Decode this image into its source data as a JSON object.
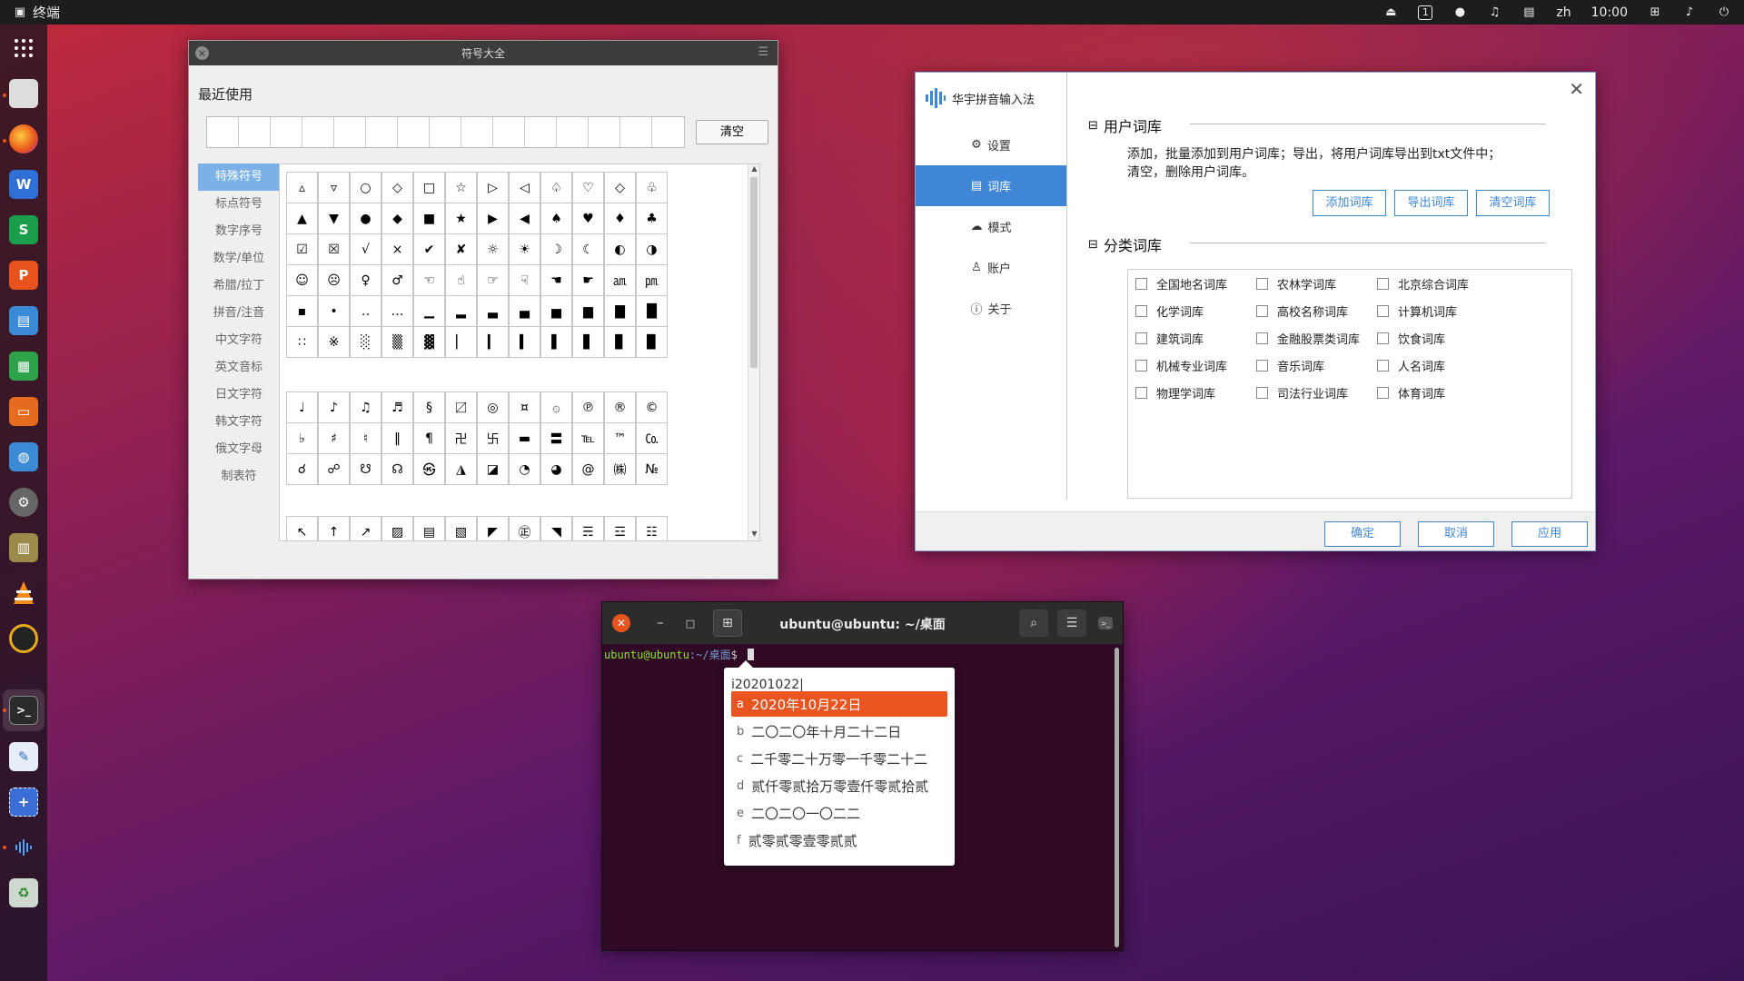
{
  "topbar": {
    "app_name": "终端",
    "lang": "zh",
    "time": "10:00"
  },
  "symbol_window": {
    "title": "符号大全",
    "recent_label": "最近使用",
    "clear_label": "清空",
    "categories": [
      "特殊符号",
      "标点符号",
      "数字序号",
      "数学/单位",
      "希腊/拉丁",
      "拼音/注音",
      "中文字符",
      "英文音标",
      "日文字符",
      "韩文字符",
      "俄文字母",
      "制表符"
    ],
    "grid1": [
      "▵",
      "▿",
      "○",
      "◇",
      "□",
      "☆",
      "▷",
      "◁",
      "♤",
      "♡",
      "◇",
      "♧",
      "▲",
      "▼",
      "●",
      "◆",
      "■",
      "★",
      "▶",
      "◀",
      "♠",
      "♥",
      "♦",
      "♣",
      "☑",
      "☒",
      "√",
      "×",
      "✔",
      "✘",
      "☼",
      "☀",
      "☽",
      "☾",
      "◐",
      "◑",
      "☺",
      "☹",
      "♀",
      "♂",
      "☜",
      "☝",
      "☞",
      "☟",
      "☚",
      "☛",
      "㏂",
      "㏘",
      "▪",
      "•",
      "‥",
      "…",
      "▁",
      "▂",
      "▃",
      "▄",
      "▅",
      "▆",
      "▇",
      "█",
      "∷",
      "※",
      "░",
      "▒",
      "▓",
      "▏",
      "▎",
      "▍",
      "▌",
      "▋",
      "▊",
      "▉"
    ],
    "grid2": [
      "♩",
      "♪",
      "♫",
      "♬",
      "§",
      "〼",
      "◎",
      "¤",
      "۞",
      "℗",
      "®",
      "©",
      "♭",
      "♯",
      "♮",
      "‖",
      "¶",
      "卍",
      "卐",
      "▬",
      "〓",
      "℡",
      "™",
      "㏇",
      "☌",
      "☍",
      "☋",
      "☊",
      "㉿",
      "◮",
      "◪",
      "◔",
      "◕",
      "@",
      "㈱",
      "№"
    ],
    "grid3": [
      "↖",
      "↑",
      "↗",
      "▨",
      "▤",
      "▧",
      "◤",
      "㊣",
      "◥",
      "☴",
      "☲",
      "☷"
    ]
  },
  "settings_window": {
    "app_name": "华宇拼音输入法",
    "nav": [
      "设置",
      "词库",
      "模式",
      "账户",
      "关于"
    ],
    "active_nav": "词库",
    "user_dict_title": "用户词库",
    "user_dict_desc_1": "添加，批量添加到用户词库；导出，将用户词库导出到txt文件中；",
    "user_dict_desc_2": "清空，删除用户词库。",
    "btn_add": "添加词库",
    "btn_export": "导出词库",
    "btn_clear": "清空词库",
    "category_title": "分类词库",
    "dicts": [
      [
        "全国地名词库",
        "农林学词库",
        "北京综合词库"
      ],
      [
        "化学词库",
        "高校名称词库",
        "计算机词库"
      ],
      [
        "建筑词库",
        "金融股票类词库",
        "饮食词库"
      ],
      [
        "机械专业词库",
        "音乐词库",
        "人名词库"
      ],
      [
        "物理学词库",
        "司法行业词库",
        "体育词库"
      ]
    ],
    "ok": "确定",
    "cancel": "取消",
    "apply": "应用"
  },
  "terminal": {
    "title": "ubuntu@ubuntu: ~/桌面",
    "prompt_user": "ubuntu@ubuntu",
    "prompt_path": ":~/桌面",
    "prompt_sign": "$"
  },
  "ime": {
    "input": "i20201022|",
    "candidates": [
      {
        "key": "a",
        "text": "2020年10月22日"
      },
      {
        "key": "b",
        "text": "二〇二〇年十月二十二日"
      },
      {
        "key": "c",
        "text": "二千零二十万零一千零二十二"
      },
      {
        "key": "d",
        "text": "贰仟零贰拾万零壹仟零贰拾贰"
      },
      {
        "key": "e",
        "text": "二〇二〇一〇二二"
      },
      {
        "key": "f",
        "text": "贰零贰零壹零贰贰"
      }
    ]
  },
  "colors": {
    "accent": "#e95420",
    "settings_blue": "#3f86d6",
    "terminal_bg": "#300a24"
  }
}
